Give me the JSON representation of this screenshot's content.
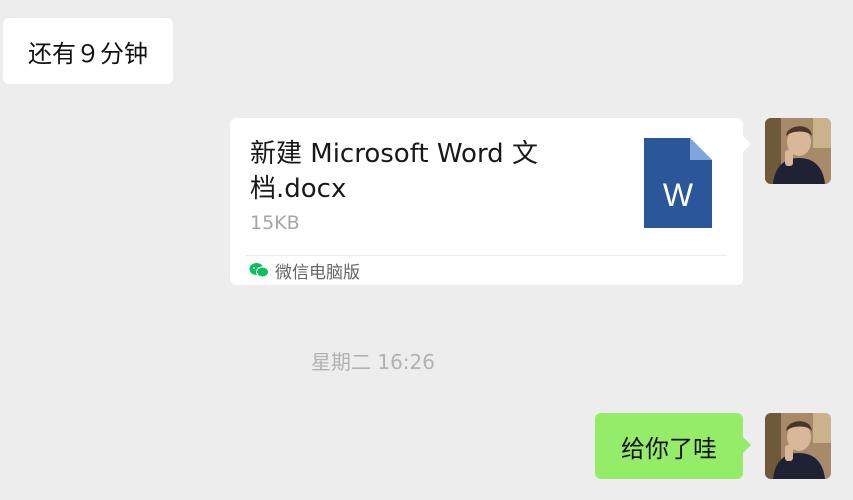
{
  "messages": {
    "incoming_text": "还有９分钟",
    "file": {
      "name": "新建 Microsoft Word 文档.docx",
      "size": "15KB",
      "source": "微信电脑版",
      "icon": "word-doc-icon"
    },
    "timestamp": "星期二 16:26",
    "outgoing_text": "给你了哇"
  },
  "colors": {
    "background": "#ededed",
    "incoming_bubble": "#ffffff",
    "outgoing_bubble": "#95ec69",
    "word_blue": "#2b579a",
    "wechat_green": "#07c160"
  }
}
